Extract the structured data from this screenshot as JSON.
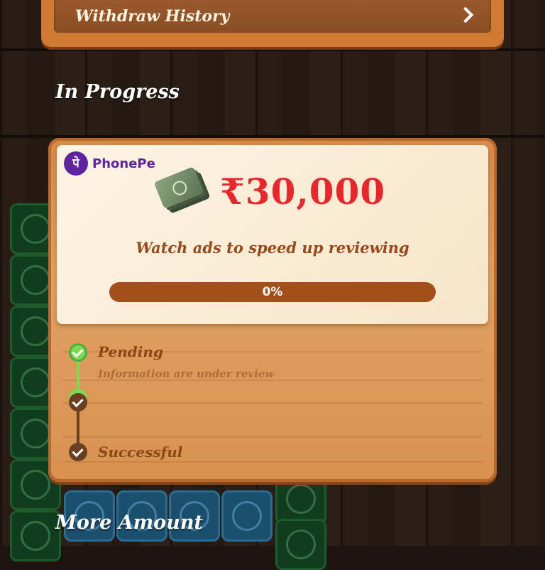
{
  "history": {
    "label": "Withdraw History"
  },
  "sections": {
    "in_progress": "In Progress",
    "more_amount": "More Amount"
  },
  "withdrawal": {
    "provider": "PhonePe",
    "provider_logo_glyph": "पे",
    "amount": "₹30,000",
    "message": "Watch ads to speed up reviewing",
    "progress_percent": 0,
    "progress_label": "0%"
  },
  "steps": [
    {
      "title": "Pending",
      "description": "Information are under review",
      "status": "active"
    },
    {
      "title": "Successful",
      "description": "",
      "status": "pending"
    }
  ],
  "colors": {
    "accent_red": "#e8262b",
    "phonepe_purple": "#5f259f",
    "step_active": "#7ed957",
    "step_pending": "#6b4020"
  },
  "icons": [
    "chevron-right-icon",
    "phonepe-logo-icon",
    "cash-icon",
    "check-icon"
  ]
}
